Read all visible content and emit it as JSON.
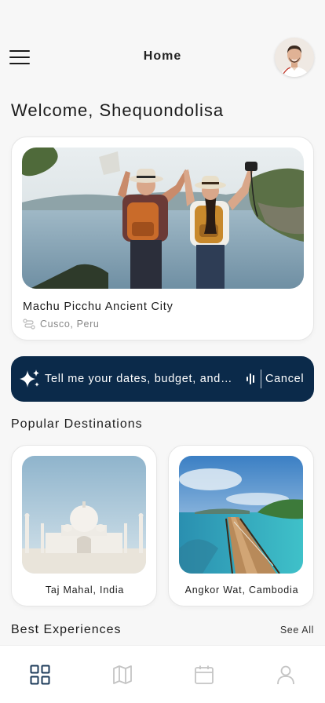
{
  "header": {
    "title": "Home"
  },
  "welcome": "Welcome, Shequondolisa",
  "featured": {
    "name": "Machu Picchu Ancient City",
    "location": "Cusco, Peru"
  },
  "ai_prompt": {
    "placeholder": "Tell me your dates, budget, and interests...",
    "display": "Tell me your dates, budget, and…",
    "cancel_label": "Cancel"
  },
  "popular": {
    "title": "Popular Destinations",
    "items": [
      {
        "label": "Taj Mahal, India"
      },
      {
        "label": "Angkor Wat, Cambodia"
      }
    ]
  },
  "experiences": {
    "title": "Best Experiences",
    "see_all": "See All"
  },
  "colors": {
    "accent": "#0b2a4a",
    "nav_active": "#1d3b5a",
    "nav_inactive": "#c4c4c4"
  },
  "nav": [
    {
      "icon": "grid-icon",
      "active": true
    },
    {
      "icon": "map-icon",
      "active": false
    },
    {
      "icon": "calendar-icon",
      "active": false
    },
    {
      "icon": "user-icon",
      "active": false
    }
  ]
}
